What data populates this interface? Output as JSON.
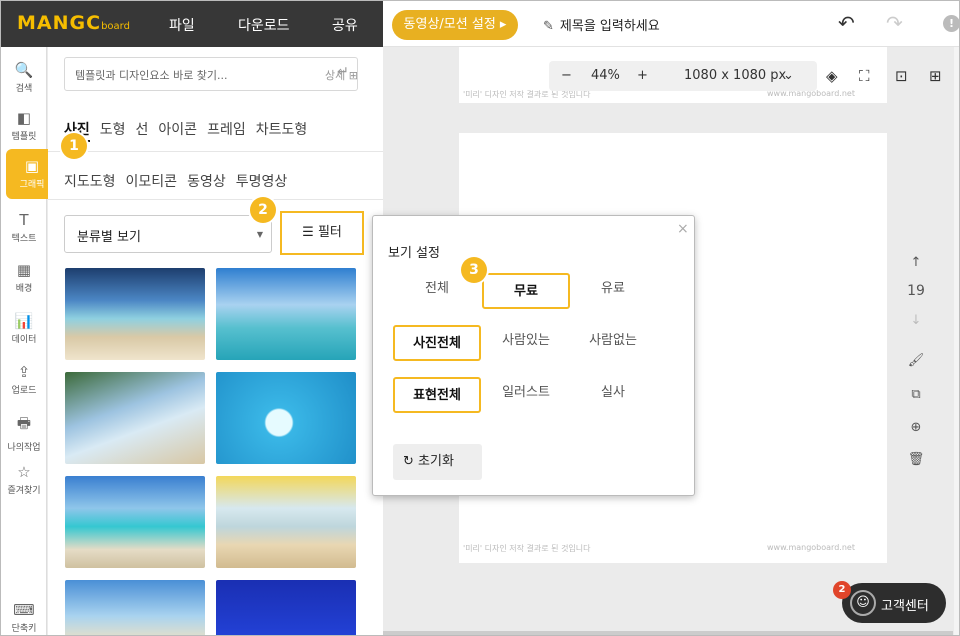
{
  "app": {
    "logo": "MANGC",
    "logo_sub": "board"
  },
  "topmenu": [
    "파일",
    "다운로드",
    "공유"
  ],
  "toolbar": {
    "motion_button": "동영상/모션 설정 ▸",
    "title_placeholder": "제목을 입력하세요",
    "undo": "↶",
    "redo": "↷",
    "info": "!"
  },
  "iconbar": [
    {
      "label": "검색",
      "icon": "🔍"
    },
    {
      "label": "템플릿",
      "icon": "◧"
    },
    {
      "label": "그래픽",
      "icon": "▣"
    },
    {
      "label": "텍스트",
      "icon": "T"
    },
    {
      "label": "배경",
      "icon": "▦"
    },
    {
      "label": "데이터",
      "icon": "📊"
    },
    {
      "label": "업로드",
      "icon": "⇪"
    },
    {
      "label": "나의작업",
      "icon": "🖶"
    },
    {
      "label": "즐겨찾기",
      "icon": "☆"
    },
    {
      "label": "단축키",
      "icon": "⌨"
    }
  ],
  "panel": {
    "search_placeholder": "템플릿과 디자인요소 바로 찾기...",
    "search_enter": "↵",
    "detail_link": "상세",
    "detail_plus": "⊞",
    "tabs_row1": [
      "사진",
      "도형",
      "선",
      "아이콘",
      "프레임",
      "차트도형"
    ],
    "tabs_row2": [
      "지도도형",
      "이모티콘",
      "동영상",
      "투명영상"
    ],
    "category_select": "분류별 보기",
    "caret": "▼",
    "filter_icon": "☰",
    "filter_button": "필터"
  },
  "badges": [
    "1",
    "2",
    "3"
  ],
  "canvas": {
    "zoom_minus": "−",
    "zoom_value": "44%",
    "zoom_plus": "+",
    "size_value": "1080 x 1080 px",
    "size_caret": "⌄",
    "watermark_left": "'미리' 디자인 저작 결과로 된 것입니다",
    "watermark_right": "www.mangoboard.net",
    "page_up": "↑",
    "page_number": "19",
    "page_down": "↓",
    "tools": [
      "🖌",
      "⧉",
      "⊕",
      "🗑"
    ],
    "layer_icon": "◈",
    "crop_icon": "⛶",
    "resize_icon": "⊡",
    "grid_icon": "⊞"
  },
  "popup": {
    "title": "보기 설정",
    "close": "×",
    "row1": [
      {
        "label": "전체",
        "on": false
      },
      {
        "label": "무료",
        "on": true
      },
      {
        "label": "유료",
        "on": false
      }
    ],
    "row2": [
      {
        "label": "사진전체",
        "on": true
      },
      {
        "label": "사람있는",
        "on": false
      },
      {
        "label": "사람없는",
        "on": false
      }
    ],
    "row3": [
      {
        "label": "표현전체",
        "on": true
      },
      {
        "label": "일러스트",
        "on": false
      },
      {
        "label": "실사",
        "on": false
      }
    ],
    "reset_icon": "↻",
    "reset_label": "초기화"
  },
  "support": {
    "label": "고객센터",
    "count": "2",
    "face": "☺"
  },
  "colors": {
    "accent": "#f5b921",
    "dark": "#373737",
    "badge": "#e0452a"
  }
}
